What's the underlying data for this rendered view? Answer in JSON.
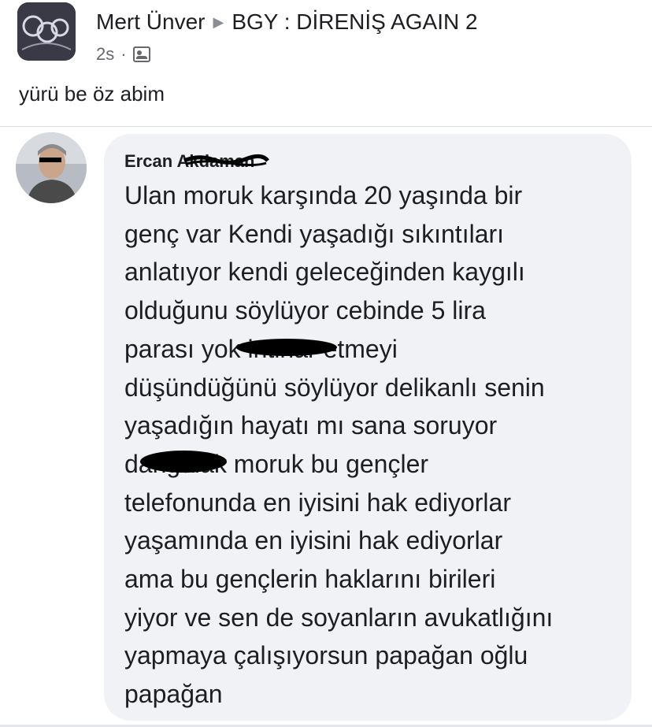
{
  "post": {
    "author": "Mert Ünver",
    "group": "BGY : DİRENİŞ AGAIN 2",
    "time": "2s",
    "meta_separator": "·",
    "text": "yürü be öz abim"
  },
  "comment": {
    "author_name": "Ercan Akdaman",
    "lines": [
      "Ulan moruk karşında 20 yaşında bir",
      "genç var Kendi yaşadığı sıkıntıları",
      "anlatıyor kendi geleceğinden kaygılı",
      "olduğunu söylüyor cebinde 5 lira",
      "parası yok intihar etmeyi",
      "düşündüğünü söylüyor delikanlı senin",
      "yaşadığın hayatı mı sana soruyor",
      "dangalak moruk bu gençler",
      "telefonunda en iyisini hak ediyorlar",
      "yaşamında en iyisini hak ediyorlar",
      "ama bu gençlerin haklarını birileri",
      "yiyor ve sen de soyanların avukatlığını",
      "yapmaya çalışıyorsun papağan oğlu",
      "papağan"
    ]
  },
  "icons": {
    "group_avatar": "group-logo-icon",
    "audience": "group-audience-icon",
    "commenter_avatar": "profile-photo-icon"
  },
  "colors": {
    "bubble": "#f0f2f5",
    "text": "#1c1e21",
    "meta": "#65676b"
  }
}
